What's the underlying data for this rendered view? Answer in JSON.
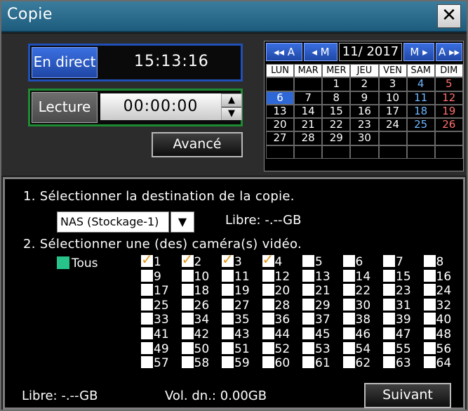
{
  "window": {
    "title": "Copie",
    "close_label": "✕"
  },
  "live": {
    "button_label": "En direct",
    "time": "15:13:16"
  },
  "playback": {
    "button_label": "Lecture",
    "time": "00:00:00",
    "up": "▲",
    "down": "▼"
  },
  "advanced_label": "Avancé",
  "calendar": {
    "nav": {
      "prev_year": "◂◂ A",
      "prev_month": "◂ M",
      "month": "11/ 2017",
      "next_month": "M ▸",
      "next_year": "A ▸▸"
    },
    "weekdays": [
      "LUN",
      "MAR",
      "MER",
      "JEU",
      "VEN",
      "SAM",
      "DIM"
    ],
    "weeks": [
      [
        "",
        "",
        "1",
        "2",
        "3",
        "4",
        "5"
      ],
      [
        "6",
        "7",
        "8",
        "9",
        "10",
        "11",
        "12"
      ],
      [
        "13",
        "14",
        "15",
        "16",
        "17",
        "18",
        "19"
      ],
      [
        "20",
        "21",
        "22",
        "23",
        "24",
        "25",
        "26"
      ],
      [
        "27",
        "28",
        "29",
        "30",
        "",
        "",
        ""
      ],
      [
        "",
        "",
        "",
        "",
        "",
        "",
        ""
      ]
    ],
    "selected_day": "6"
  },
  "copy": {
    "step1": "1. Sélectionner la destination de la copie.",
    "destination": "NAS (Stockage-1)",
    "libre_top": "Libre:  -.--GB",
    "step2": "2. Sélectionner une (des) caméra(s) vidéo.",
    "all_label": "Tous",
    "cameras": [
      [
        "1",
        "2",
        "3",
        "4",
        "5",
        "6",
        "7",
        "8"
      ],
      [
        "9",
        "10",
        "11",
        "12",
        "13",
        "14",
        "15",
        "16"
      ],
      [
        "17",
        "18",
        "19",
        "20",
        "21",
        "22",
        "23",
        "24"
      ],
      [
        "25",
        "26",
        "27",
        "28",
        "29",
        "30",
        "31",
        "32"
      ],
      [
        "33",
        "34",
        "35",
        "36",
        "37",
        "38",
        "39",
        "40"
      ],
      [
        "41",
        "42",
        "43",
        "44",
        "45",
        "46",
        "47",
        "48"
      ],
      [
        "49",
        "50",
        "51",
        "52",
        "53",
        "54",
        "55",
        "56"
      ],
      [
        "57",
        "58",
        "59",
        "60",
        "61",
        "62",
        "63",
        "64"
      ]
    ],
    "checked_cameras": [
      "1",
      "2",
      "3",
      "4"
    ],
    "footer_libre": "Libre:  -.--GB",
    "footer_vol": "Vol. dn.:   0.00GB",
    "next_label": "Suivant"
  },
  "colors": {
    "title_bar": "#2f6f90",
    "live_border": "#1f4fb8",
    "play_border": "#1e8a33",
    "check_mark": "#e29b1b",
    "saturday": "#6fb7ff",
    "sunday": "#ff6f6f"
  }
}
